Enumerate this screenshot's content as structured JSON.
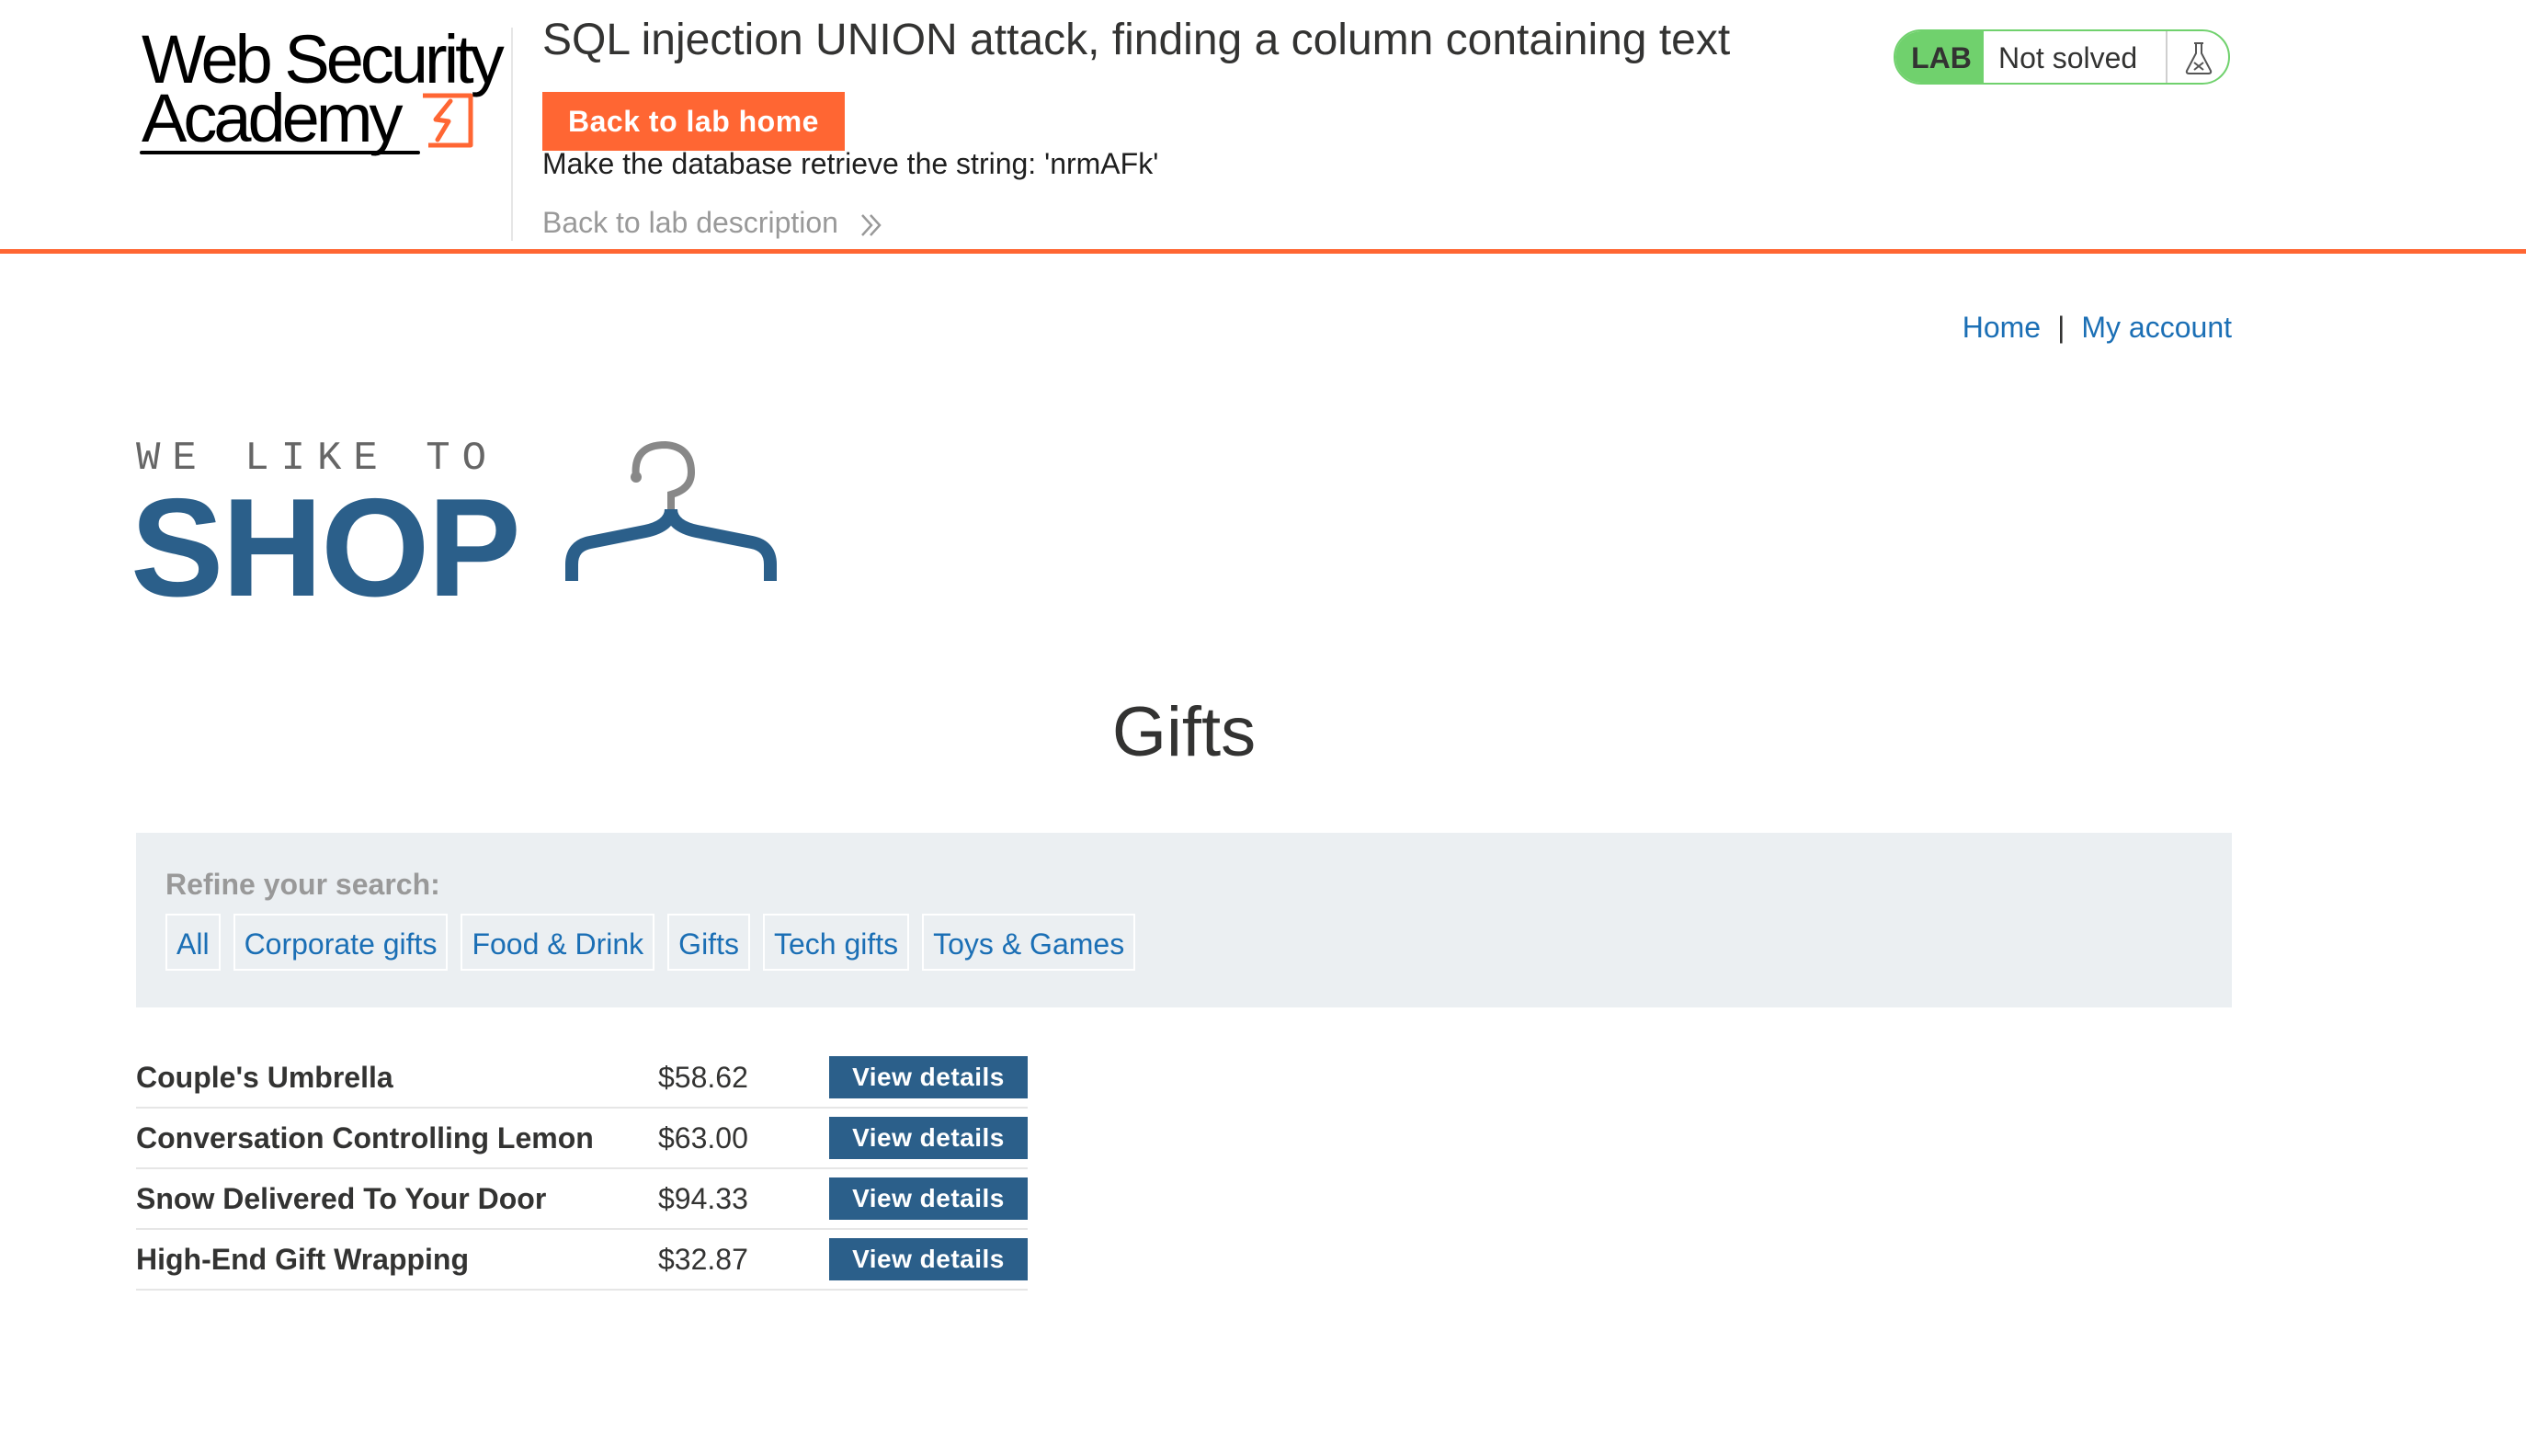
{
  "academy": {
    "logo_line1": "Web Security",
    "logo_line2": "Academy",
    "lab_title": "SQL injection UNION attack, finding a column containing text",
    "back_to_lab_home": "Back to lab home",
    "objective": "Make the database retrieve the string: 'nrmAFk'",
    "back_to_lab_description": "Back to lab description",
    "lab_badge": "LAB",
    "lab_status": "Not solved",
    "accent_color": "#ff6633",
    "status_color": "#70d16d"
  },
  "nav": {
    "home": "Home",
    "separator": "|",
    "my_account": "My account"
  },
  "shop_logo": {
    "tagline": "WE LIKE TO",
    "word": "SHOP",
    "brand_color": "#2b5f8a"
  },
  "page": {
    "title": "Gifts"
  },
  "filters": {
    "label": "Refine your search:",
    "items": [
      "All",
      "Corporate gifts",
      "Food & Drink",
      "Gifts",
      "Tech gifts",
      "Toys & Games"
    ]
  },
  "products": [
    {
      "name": "Couple's Umbrella",
      "price": "$58.62",
      "action": "View details"
    },
    {
      "name": "Conversation Controlling Lemon",
      "price": "$63.00",
      "action": "View details"
    },
    {
      "name": "Snow Delivered To Your Door",
      "price": "$94.33",
      "action": "View details"
    },
    {
      "name": "High-End Gift Wrapping",
      "price": "$32.87",
      "action": "View details"
    }
  ]
}
